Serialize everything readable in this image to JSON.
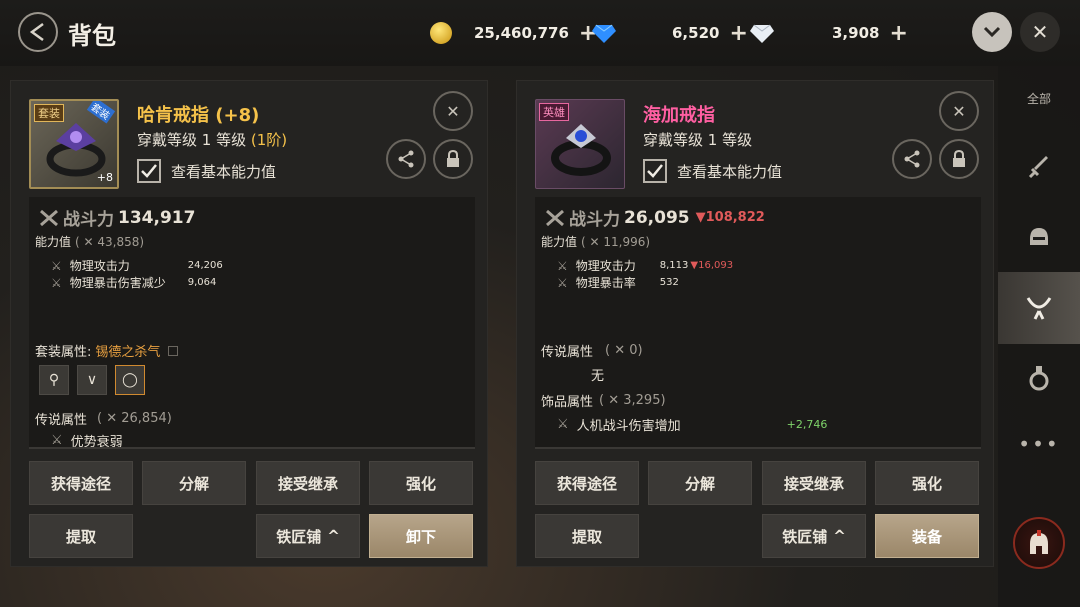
{
  "header": {
    "title": "背包"
  },
  "currencies": [
    {
      "icon": "gold-coin-icon",
      "value": "25,460,776"
    },
    {
      "icon": "blue-diamond-icon",
      "value": "6,520"
    },
    {
      "icon": "white-diamond-icon",
      "value": "3,908"
    }
  ],
  "sidebar": {
    "all_label": "全部"
  },
  "left": {
    "tag": "套装",
    "corner_tag": "套装",
    "enhance": "+8",
    "name": "哈肯戒指 (+8)",
    "level_text": "穿戴等级 1 等级",
    "tier": "(1阶)",
    "check_label": "查看基本能力值",
    "power_label": "战斗力",
    "power_value": "134,917",
    "ability_label": "能力值",
    "ability_value": "( ✕ 43,858)",
    "stats": [
      {
        "name": "物理攻击力",
        "value": "24,206"
      },
      {
        "name": "物理暴击伤害减少",
        "value": "9,064"
      }
    ],
    "set_label": "套装属性:",
    "set_name": "锡德之杀气",
    "legend_label": "传说属性",
    "legend_value": "( ✕ 26,854)",
    "legend_item": "优势衰弱",
    "buttons": {
      "obtain": "获得途径",
      "decompose": "分解",
      "inherit": "接受继承",
      "enhance": "强化",
      "extract": "提取",
      "smith": "铁匠铺",
      "unequip": "卸下"
    }
  },
  "right": {
    "tag": "英雄",
    "name": "海加戒指",
    "level_text": "穿戴等级 1 等级",
    "check_label": "查看基本能力值",
    "power_label": "战斗力",
    "power_value": "26,095",
    "power_diff": "▼108,822",
    "ability_label": "能力值",
    "ability_value": "( ✕ 11,996)",
    "stats": [
      {
        "name": "物理攻击力",
        "value": "8,113",
        "diff": "▼16,093"
      },
      {
        "name": "物理暴击率",
        "value": "532",
        "diff": ""
      }
    ],
    "legend_label": "传说属性",
    "legend_value": "( ✕ 0)",
    "legend_none": "无",
    "acc_label": "饰品属性",
    "acc_value": "( ✕ 3,295)",
    "acc_item": "人机战斗伤害增加",
    "acc_item_value": "+2,746",
    "buttons": {
      "obtain": "获得途径",
      "decompose": "分解",
      "inherit": "接受继承",
      "enhance": "强化",
      "extract": "提取",
      "smith": "铁匠铺",
      "equip": "装备"
    }
  },
  "colors": {
    "gold": "#f5c24a",
    "pink": "#ff5fa2",
    "set_orange": "#e8a040",
    "down_red": "#e05a5a",
    "up_green": "#7fd46a"
  }
}
